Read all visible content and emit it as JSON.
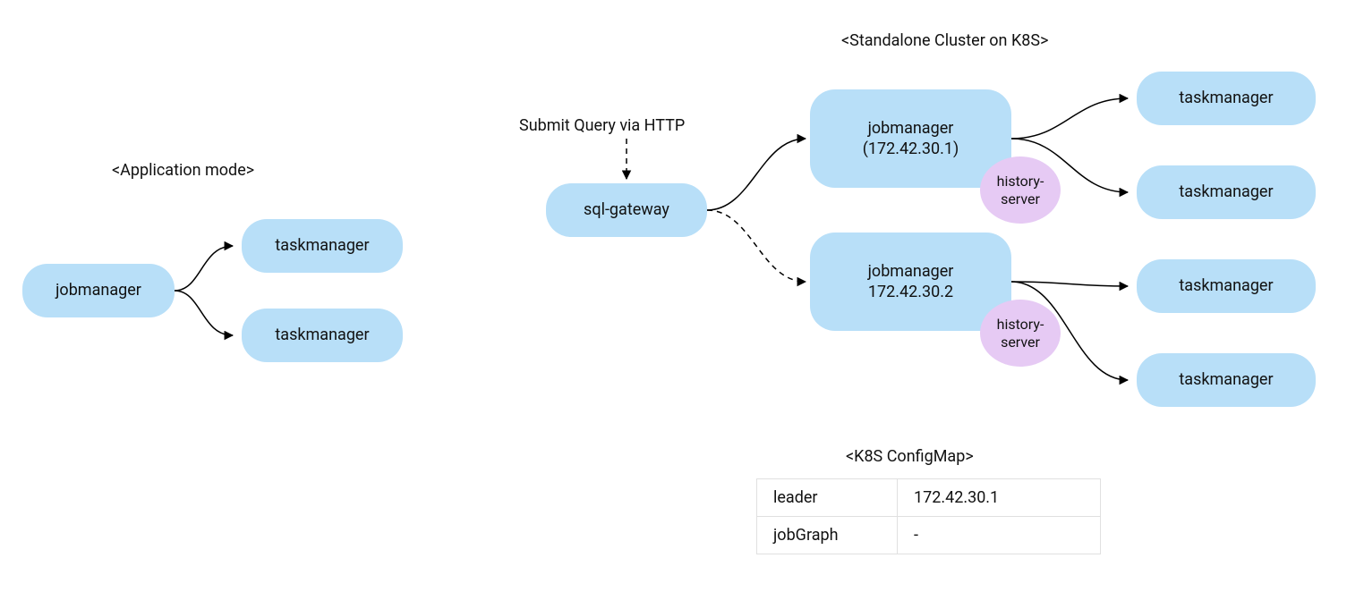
{
  "titles": {
    "app_mode": "<Application mode>",
    "standalone": "<Standalone Cluster on K8S>",
    "configmap": "<K8S ConfigMap>"
  },
  "labels": {
    "submit_http": "Submit Query via HTTP"
  },
  "left": {
    "jobmanager": "jobmanager",
    "tm1": "taskmanager",
    "tm2": "taskmanager"
  },
  "center": {
    "sql_gateway": "sql-gateway"
  },
  "right": {
    "jm1_line1": "jobmanager",
    "jm1_line2": "(172.42.30.1)",
    "jm2_line1": "jobmanager",
    "jm2_line2": "172.42.30.2",
    "history_server": "history-\nserver",
    "tm_a": "taskmanager",
    "tm_b": "taskmanager",
    "tm_c": "taskmanager",
    "tm_d": "taskmanager"
  },
  "config": {
    "leader_k": "leader",
    "leader_v": "172.42.30.1",
    "jobgraph_k": "jobGraph",
    "jobgraph_v": "-"
  }
}
